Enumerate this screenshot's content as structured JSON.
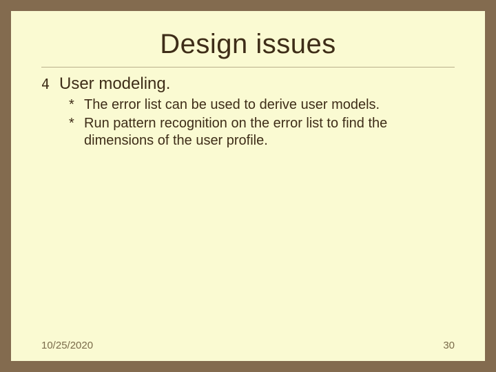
{
  "slide": {
    "title": "Design issues",
    "bullet_marker": "4",
    "bullet_text": "User modeling.",
    "sub_marker": "*",
    "sub_items": [
      "The error list can be used to derive user models.",
      "Run pattern recognition on the error list to find the dimensions of the user profile."
    ],
    "footer": {
      "date": "10/25/2020",
      "page": "30"
    }
  }
}
